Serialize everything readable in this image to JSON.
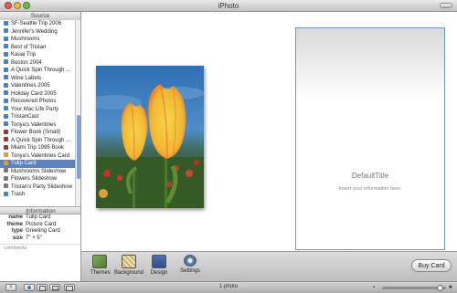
{
  "window": {
    "title": "iPhoto"
  },
  "sidebar": {
    "source_label": "Source",
    "items": [
      {
        "label": "SF-Seattle Trip 2006",
        "kind": "album"
      },
      {
        "label": "Jennifer's Wedding",
        "kind": "album"
      },
      {
        "label": "Mushrooms",
        "kind": "album"
      },
      {
        "label": "Best of Tristan",
        "kind": "album"
      },
      {
        "label": "Kauai Trip",
        "kind": "album"
      },
      {
        "label": "Boston 2004",
        "kind": "album"
      },
      {
        "label": "A Quick Spin Through ...",
        "kind": "album"
      },
      {
        "label": "Wine Labels",
        "kind": "album"
      },
      {
        "label": "Valentines 2005",
        "kind": "album"
      },
      {
        "label": "Holiday Card 2005",
        "kind": "album"
      },
      {
        "label": "Recovered Photos",
        "kind": "album"
      },
      {
        "label": "Your Mac Life Party",
        "kind": "album"
      },
      {
        "label": "TristanCast",
        "kind": "album"
      },
      {
        "label": "Tonya's Valentines",
        "kind": "album"
      },
      {
        "label": "Flower Book (Small)",
        "kind": "book"
      },
      {
        "label": "A Quick Spin Through ...",
        "kind": "book"
      },
      {
        "label": "Miami Trip 1995 Book",
        "kind": "book"
      },
      {
        "label": "Tonya's Valentines Card",
        "kind": "card"
      },
      {
        "label": "Tulip Card",
        "kind": "card",
        "selected": true
      },
      {
        "label": "Mushrooms Slideshow",
        "kind": "slideshow"
      },
      {
        "label": "Flowers Slideshow",
        "kind": "slideshow"
      },
      {
        "label": "Tristan's Party Slideshow",
        "kind": "slideshow"
      },
      {
        "label": "Trash",
        "kind": "trash"
      }
    ],
    "information_label": "Information",
    "info": [
      {
        "key": "name",
        "value": "Tulip Card"
      },
      {
        "key": "theme",
        "value": "Picture Card"
      },
      {
        "key": "type",
        "value": "Greeting Card"
      },
      {
        "key": "size",
        "value": "7\" × 5\""
      }
    ],
    "comments_placeholder": "comments"
  },
  "card": {
    "title": "DefaultTitle",
    "subtitle": "Insert your information here."
  },
  "toolbar": {
    "themes": "Themes",
    "background": "Background",
    "design": "Design",
    "settings": "Settings",
    "buy_card": "Buy Card"
  },
  "status": {
    "photo_count": "1 photo"
  },
  "bottom_buttons": {
    "add": "+"
  },
  "colors": {
    "selection": "#5a83c4",
    "card_border": "#6e96c8",
    "accent": "#4f7fbf"
  },
  "zoom_level": 0.95
}
